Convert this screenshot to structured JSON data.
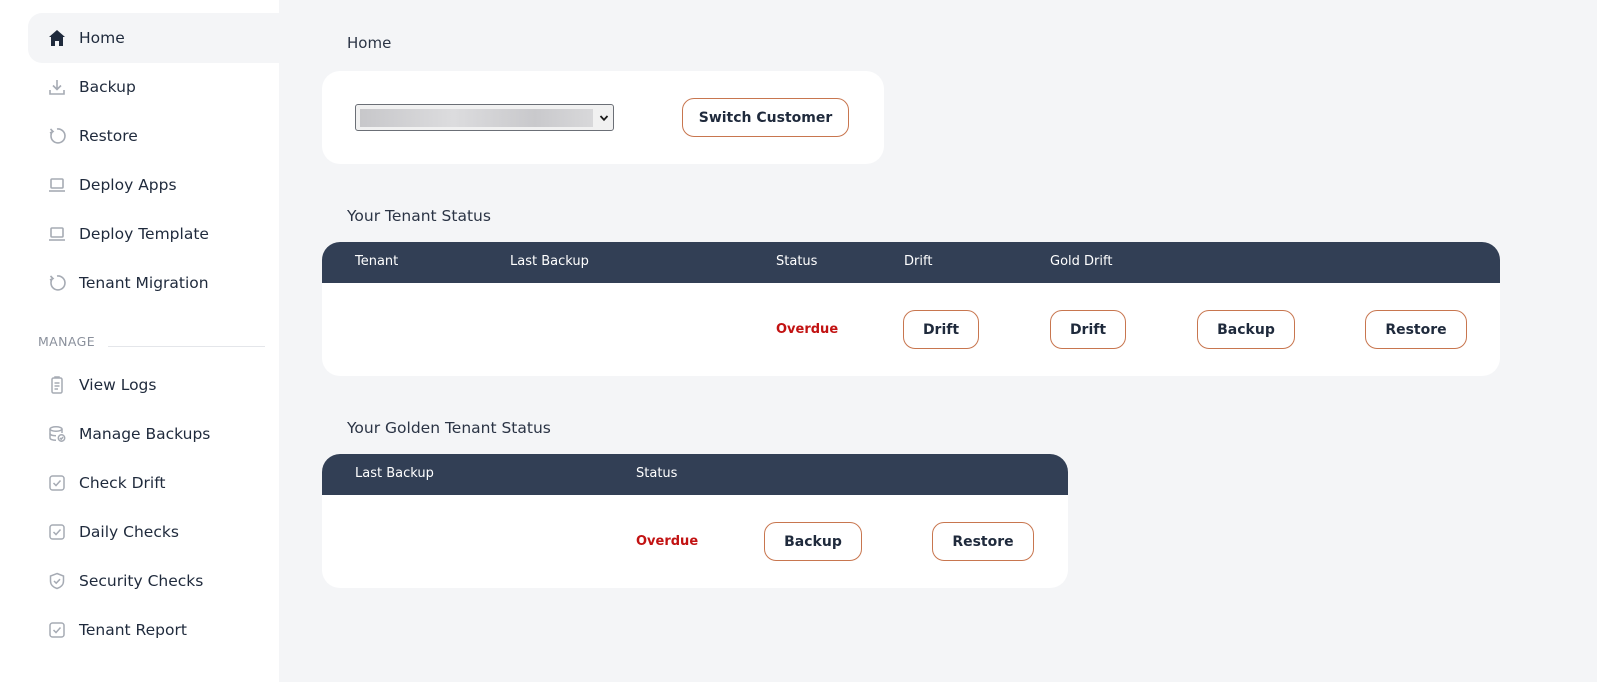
{
  "sidebar": {
    "items": [
      {
        "label": "Home",
        "icon": "home-icon"
      },
      {
        "label": "Backup",
        "icon": "download-icon"
      },
      {
        "label": "Restore",
        "icon": "restore-icon"
      },
      {
        "label": "Deploy Apps",
        "icon": "laptop-icon"
      },
      {
        "label": "Deploy Template",
        "icon": "laptop-icon"
      },
      {
        "label": "Tenant Migration",
        "icon": "restore-icon"
      }
    ],
    "manage_label": "MANAGE",
    "manage_items": [
      {
        "label": "View Logs",
        "icon": "clipboard-icon"
      },
      {
        "label": "Manage Backups",
        "icon": "database-icon"
      },
      {
        "label": "Check Drift",
        "icon": "check-square-icon"
      },
      {
        "label": "Daily Checks",
        "icon": "check-square-icon"
      },
      {
        "label": "Security Checks",
        "icon": "shield-check-icon"
      },
      {
        "label": "Tenant Report",
        "icon": "check-square-icon"
      }
    ]
  },
  "page": {
    "title": "Home"
  },
  "customer": {
    "switch_label": "Switch Customer"
  },
  "tenant_status": {
    "title": "Your Tenant Status",
    "columns": [
      "Tenant",
      "Last Backup",
      "Status",
      "Drift",
      "Gold Drift"
    ],
    "row": {
      "tenant": "",
      "last_backup": "",
      "status": "Overdue",
      "drift_label": "Drift",
      "gold_drift_label": "Drift",
      "backup_label": "Backup",
      "restore_label": "Restore"
    }
  },
  "golden_status": {
    "title": "Your Golden Tenant Status",
    "columns": [
      "Last Backup",
      "Status"
    ],
    "row": {
      "last_backup": "",
      "status": "Overdue",
      "backup_label": "Backup",
      "restore_label": "Restore"
    }
  },
  "colors": {
    "header_bg": "#323f55",
    "accent_border": "#c8764f",
    "overdue": "#c21212",
    "page_bg": "#f4f5f7"
  }
}
